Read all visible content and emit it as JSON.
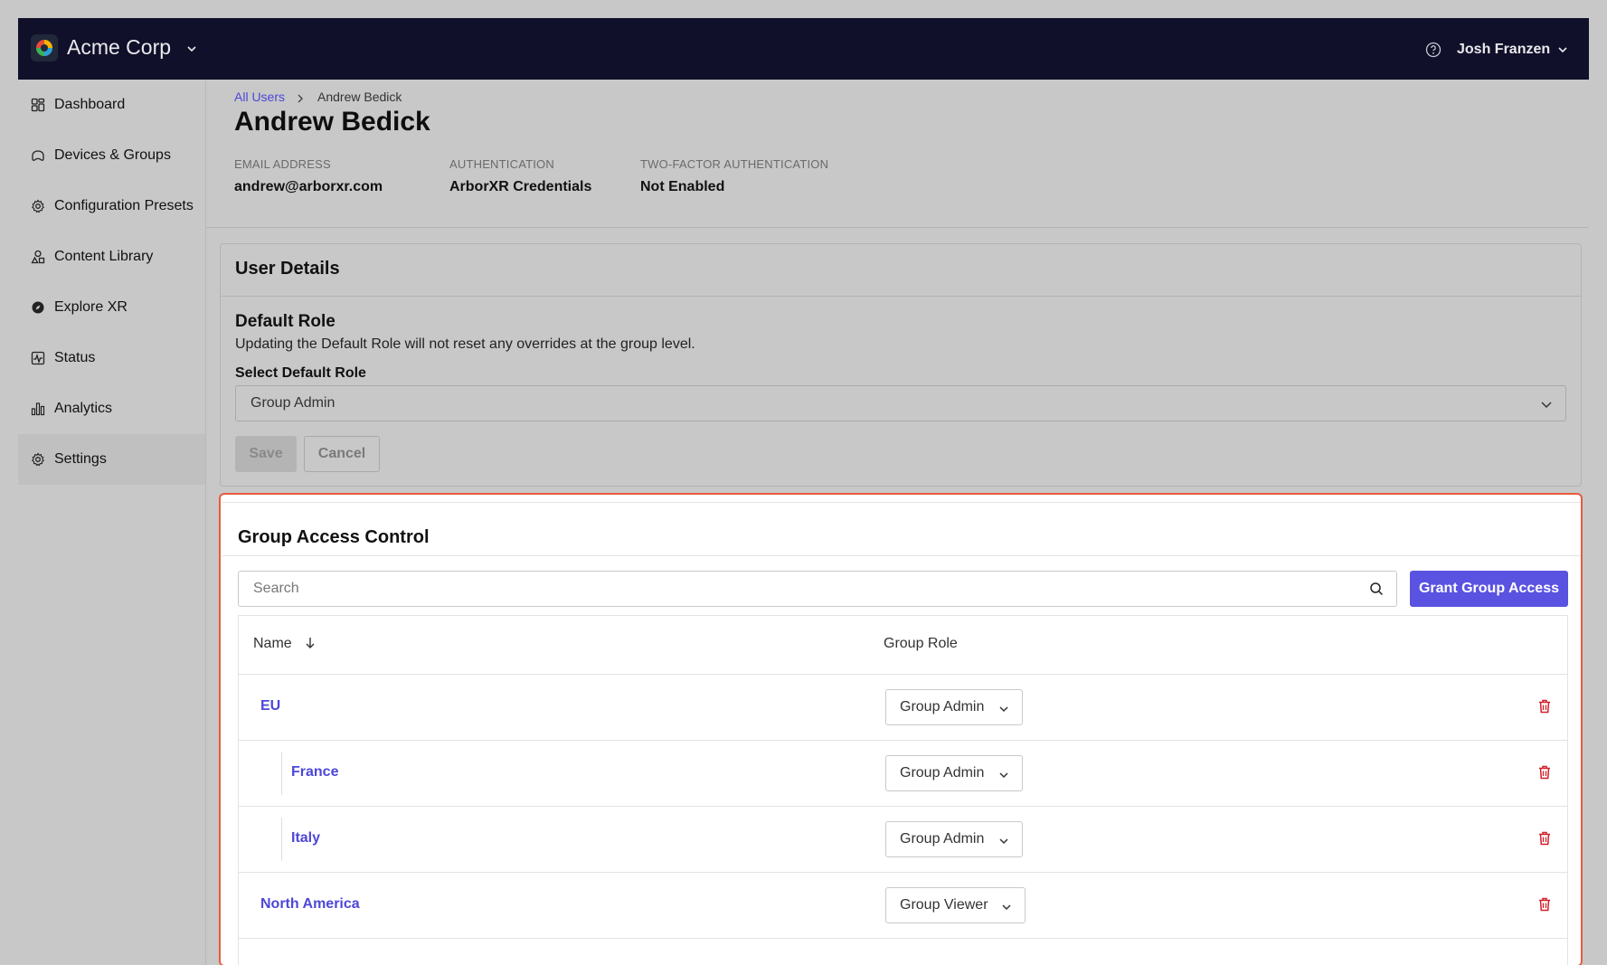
{
  "topbar": {
    "org_name": "Acme Corp",
    "user_name": "Josh Franzen"
  },
  "sidebar": {
    "items": [
      {
        "label": "Dashboard",
        "icon": "dashboard-icon"
      },
      {
        "label": "Devices & Groups",
        "icon": "headset-icon"
      },
      {
        "label": "Configuration Presets",
        "icon": "gear-icon"
      },
      {
        "label": "Content Library",
        "icon": "shapes-icon"
      },
      {
        "label": "Explore XR",
        "icon": "compass-icon"
      },
      {
        "label": "Status",
        "icon": "pulse-icon"
      },
      {
        "label": "Analytics",
        "icon": "bar-chart-icon"
      },
      {
        "label": "Settings",
        "icon": "gear-icon"
      }
    ],
    "active": "Settings"
  },
  "header": {
    "breadcrumb_root": "All Users",
    "breadcrumb_current": "Andrew Bedick",
    "title": "Andrew Bedick",
    "meta": [
      {
        "label": "EMAIL ADDRESS",
        "value": "andrew@arborxr.com"
      },
      {
        "label": "AUTHENTICATION",
        "value": "ArborXR Credentials"
      },
      {
        "label": "TWO-FACTOR AUTHENTICATION",
        "value": "Not Enabled"
      }
    ]
  },
  "user_details": {
    "title": "User Details",
    "default_role_heading": "Default Role",
    "default_role_desc": "Updating the Default Role will not reset any overrides at the group level.",
    "select_label": "Select Default Role",
    "selected_role": "Group Admin",
    "save_label": "Save",
    "cancel_label": "Cancel"
  },
  "group_access": {
    "title": "Group Access Control",
    "search_placeholder": "Search",
    "grant_label": "Grant Group Access",
    "columns": {
      "name": "Name",
      "role": "Group Role"
    },
    "rows": [
      {
        "name": "EU",
        "role": "Group Admin",
        "indent": false
      },
      {
        "name": "France",
        "role": "Group Admin",
        "indent": true
      },
      {
        "name": "Italy",
        "role": "Group Admin",
        "indent": true
      },
      {
        "name": "North America",
        "role": "Group Viewer",
        "indent": false
      }
    ]
  },
  "colors": {
    "topbar": "#11102a",
    "accent": "#5a52e0",
    "link": "#4d47d8",
    "highlight_border": "#ea5a3f",
    "delete": "#d0202a"
  }
}
